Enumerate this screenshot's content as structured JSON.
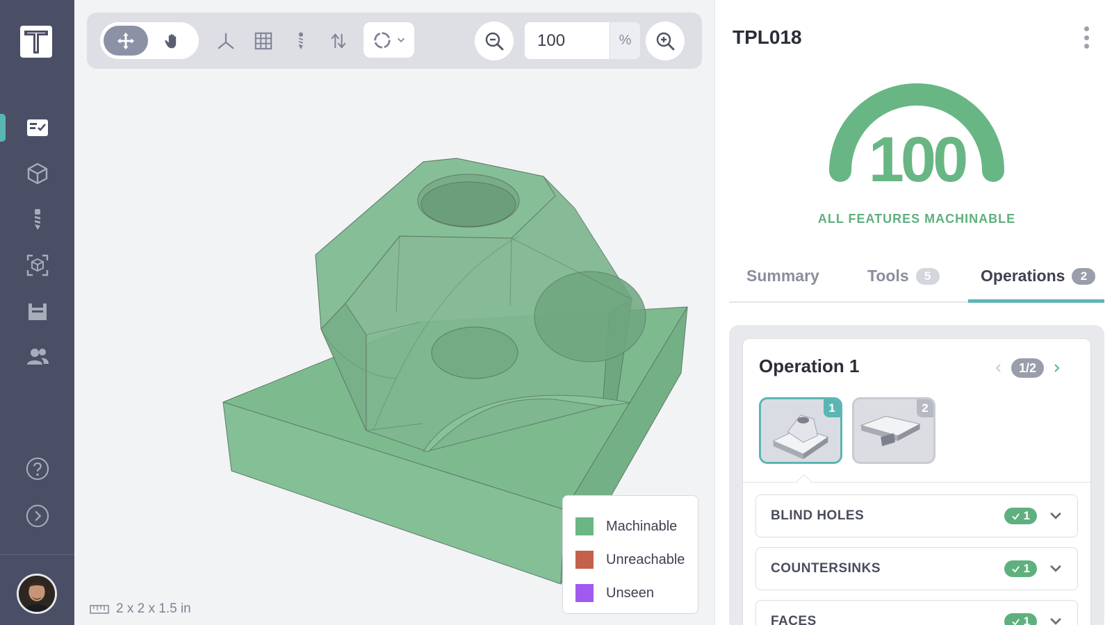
{
  "sidebar": {
    "logo_icon": "t-logo-icon",
    "items": [
      {
        "name": "checklist-icon",
        "active": true
      },
      {
        "name": "cube-icon",
        "active": false
      },
      {
        "name": "drill-bit-icon",
        "active": false
      },
      {
        "name": "scan-cube-icon",
        "active": false
      },
      {
        "name": "fixture-icon",
        "active": false
      },
      {
        "name": "users-icon",
        "active": false
      }
    ],
    "bottom_items": [
      "help-icon",
      "expand-icon"
    ]
  },
  "toolbar": {
    "zoom_value": "100",
    "zoom_unit": "%",
    "icons": [
      "move-icon",
      "hand-icon",
      "axes-icon",
      "grid-icon",
      "drill-bit-icon",
      "flip-icon",
      "view-cube-icon",
      "zoom-out-icon",
      "zoom-in-icon"
    ]
  },
  "viewer": {
    "dimensions": "2 x 2 x 1.5 in",
    "legend": [
      {
        "label": "Machinable",
        "color": "#6ab684"
      },
      {
        "label": "Unreachable",
        "color": "#c4614c"
      },
      {
        "label": "Unseen",
        "color": "#a05af0"
      }
    ]
  },
  "panel": {
    "part_name": "TPL018",
    "score": "100",
    "score_label": "ALL FEATURES MACHINABLE",
    "tabs": [
      {
        "label": "Summary",
        "count": null,
        "active": false
      },
      {
        "label": "Tools",
        "count": "5",
        "active": false
      },
      {
        "label": "Operations",
        "count": "2",
        "active": true
      }
    ],
    "operation": {
      "title": "Operation 1",
      "pager": "1/2",
      "setups": [
        "1",
        "2"
      ],
      "features": [
        {
          "name": "BLIND HOLES",
          "count": "1"
        },
        {
          "name": "COUNTERSINKS",
          "count": "1"
        },
        {
          "name": "FACES",
          "count": "1"
        }
      ]
    }
  },
  "colors": {
    "sidebar": "#4b4f66",
    "accent": "#5bb6b3",
    "machinable": "#6ab684"
  }
}
